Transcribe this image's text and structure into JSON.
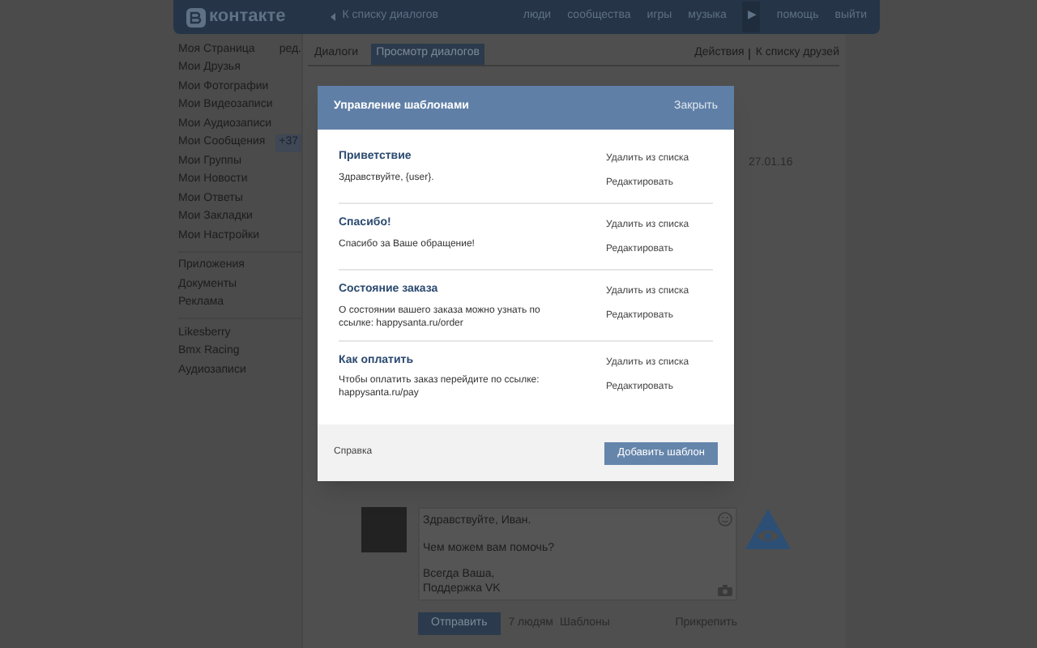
{
  "header": {
    "logo": "контакте",
    "back_link": "К списку диалогов",
    "nav": [
      "люди",
      "сообщества",
      "игры",
      "музыка"
    ],
    "nav_more": "▶",
    "right_links": [
      "помощь",
      "выйти"
    ]
  },
  "sidebar": {
    "groups": [
      [
        {
          "label": "Моя Страница",
          "extra": "ред."
        },
        {
          "label": "Мои Друзья"
        },
        {
          "label": "Мои Фотографии"
        },
        {
          "label": "Мои Видеозаписи"
        },
        {
          "label": "Мои Аудиозаписи"
        },
        {
          "label": "Мои Сообщения",
          "badge": "+37"
        },
        {
          "label": "Мои Группы"
        },
        {
          "label": "Мои Новости"
        },
        {
          "label": "Мои Ответы"
        },
        {
          "label": "Мои Закладки"
        },
        {
          "label": "Мои Настройки"
        }
      ],
      [
        {
          "label": "Приложения"
        },
        {
          "label": "Документы"
        },
        {
          "label": "Реклама"
        }
      ],
      [
        {
          "label": "Likesberry"
        },
        {
          "label": "Bmx Racing"
        },
        {
          "label": "Аудиозаписи"
        }
      ]
    ]
  },
  "tabs": [
    {
      "label": "Диалоги",
      "selected": false
    },
    {
      "label": "Просмотр диалогов",
      "selected": true
    }
  ],
  "actions": [
    "Действия",
    "К списку друзей"
  ],
  "message_date": "27.01.16",
  "composer": {
    "paragraphs": [
      [
        "Здравствуйте, Иван."
      ],
      [
        "Чем можем вам помочь?"
      ],
      [
        "Всегда Ваша,",
        "Поддержка VK"
      ]
    ],
    "send": "Отправить",
    "recipients": "7 людям",
    "templates": "Шаблоны",
    "attach": "Прикрепить"
  },
  "dialog": {
    "title": "Управление шаблонами",
    "close": "Закрыть",
    "templates": [
      {
        "name": "Приветствие",
        "text": "Здравствуйте, {user}.",
        "delete": "Удалить из списка",
        "edit": "Редактировать"
      },
      {
        "name": "Спасибо!",
        "text": "Спасибо за Ваше обращение!",
        "delete": "Удалить из списка",
        "edit": "Редактировать"
      },
      {
        "name": "Состояние заказа",
        "text": "О состоянии вашего заказа можно узнать по ссылке: happysanta.ru/order",
        "delete": "Удалить из списка",
        "edit": "Редактировать"
      },
      {
        "name": "Как оплатить",
        "text": "Чтобы оплатить заказ перейдите по ссылке: happysanta.ru/pay",
        "delete": "Удалить из списка",
        "edit": "Редактировать"
      }
    ],
    "help": "Справка",
    "add": "Добавить шаблон"
  }
}
